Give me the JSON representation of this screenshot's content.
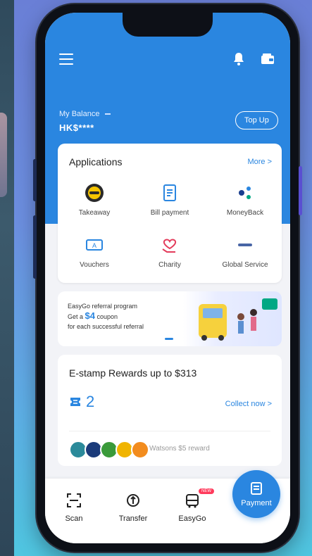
{
  "header": {
    "balance_label": "My Balance",
    "balance_value": "HK$****",
    "topup_label": "Top Up"
  },
  "applications": {
    "title": "Applications",
    "more_label": "More >",
    "items": [
      {
        "label": "Takeaway",
        "icon": "takeaway-icon"
      },
      {
        "label": "Bill payment",
        "icon": "bill-icon"
      },
      {
        "label": "MoneyBack",
        "icon": "moneyback-icon"
      },
      {
        "label": "Vouchers",
        "icon": "voucher-icon"
      },
      {
        "label": "Charity",
        "icon": "charity-icon"
      },
      {
        "label": "Global Service",
        "icon": "global-service-icon"
      }
    ]
  },
  "referral": {
    "line1": "EasyGo referral program",
    "line2_prefix": "Get a",
    "amount": "$4",
    "line2_suffix": "coupon",
    "line3": "for each successful referral"
  },
  "estamp": {
    "title": "E-stamp Rewards up to $313",
    "count": "2",
    "collect_label": "Collect now >",
    "reward_text": "Watsons $5 reward"
  },
  "bottom_nav": {
    "scan": "Scan",
    "transfer": "Transfer",
    "easygo": "EasyGo",
    "new_badge": "NEW",
    "payment": "Payment"
  },
  "colors": {
    "primary": "#2a86e0",
    "background": "#f2f3f7"
  }
}
